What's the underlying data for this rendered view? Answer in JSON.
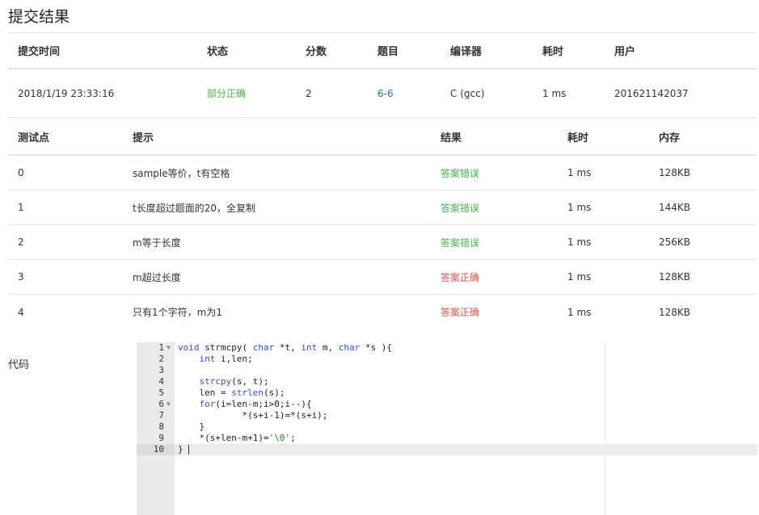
{
  "page_title": "提交结果",
  "submission": {
    "headers": [
      "提交时间",
      "状态",
      "分数",
      "题目",
      "编译器",
      "耗时",
      "用户"
    ],
    "row": {
      "time": "2018/1/19 23:33:16",
      "status": "部分正确",
      "score": "2",
      "problem": "6-6",
      "compiler": "C (gcc)",
      "duration": "1 ms",
      "user": "201621142037"
    }
  },
  "testcases": {
    "headers": [
      "测试点",
      "提示",
      "结果",
      "耗时",
      "内存"
    ],
    "rows": [
      {
        "id": "0",
        "hint": "sample等价，t有空格",
        "result": "答案错误",
        "time": "1 ms",
        "memory": "128KB"
      },
      {
        "id": "1",
        "hint": "t长度超过题面的20，全复制",
        "result": "答案错误",
        "time": "1 ms",
        "memory": "144KB"
      },
      {
        "id": "2",
        "hint": "m等于长度",
        "result": "答案错误",
        "time": "1 ms",
        "memory": "256KB"
      },
      {
        "id": "3",
        "hint": "m超过长度",
        "result": "答案正确",
        "time": "1 ms",
        "memory": "128KB"
      },
      {
        "id": "4",
        "hint": "只有1个字符，m为1",
        "result": "答案正确",
        "time": "1 ms",
        "memory": "128KB"
      }
    ]
  },
  "code_label": "代码",
  "code": {
    "lines": [
      {
        "n": "1",
        "t": "void strmcpy( char *t, int m, char *s ){"
      },
      {
        "n": "2",
        "t": "    int i,len;"
      },
      {
        "n": "3",
        "t": ""
      },
      {
        "n": "4",
        "t": "    strcpy(s, t);"
      },
      {
        "n": "5",
        "t": "    len = strlen(s);"
      },
      {
        "n": "6",
        "t": "    for(i=len-m;i>0;i--){"
      },
      {
        "n": "7",
        "t": "            *(s+i-1)=*(s+i);"
      },
      {
        "n": "8",
        "t": "    }"
      },
      {
        "n": "9",
        "t": "    *(s+len-m+1)='\\0';"
      },
      {
        "n": "10",
        "t": "}"
      }
    ]
  },
  "colors": {
    "status_partial": "#4caf50",
    "result_wrong": "#4caf50",
    "result_correct": "#e05050",
    "link": "#2a6fb0"
  }
}
